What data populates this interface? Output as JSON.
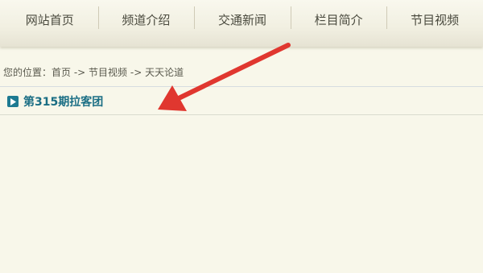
{
  "nav": {
    "items": [
      {
        "label": "网站首页"
      },
      {
        "label": "频道介绍"
      },
      {
        "label": "交通新闻"
      },
      {
        "label": "栏目简介"
      },
      {
        "label": "节目视频"
      }
    ]
  },
  "breadcrumb": {
    "prefix": "您的位置：",
    "home": "首页",
    "sep1": " -> ",
    "section": "节目视频",
    "sep2": " -> ",
    "current": "天天论道"
  },
  "episode": {
    "title": "第315期拉客团",
    "icon": "play-icon"
  },
  "colors": {
    "background": "#f8f7ea",
    "accent": "#1a6e84",
    "arrow": "#e0372f"
  }
}
